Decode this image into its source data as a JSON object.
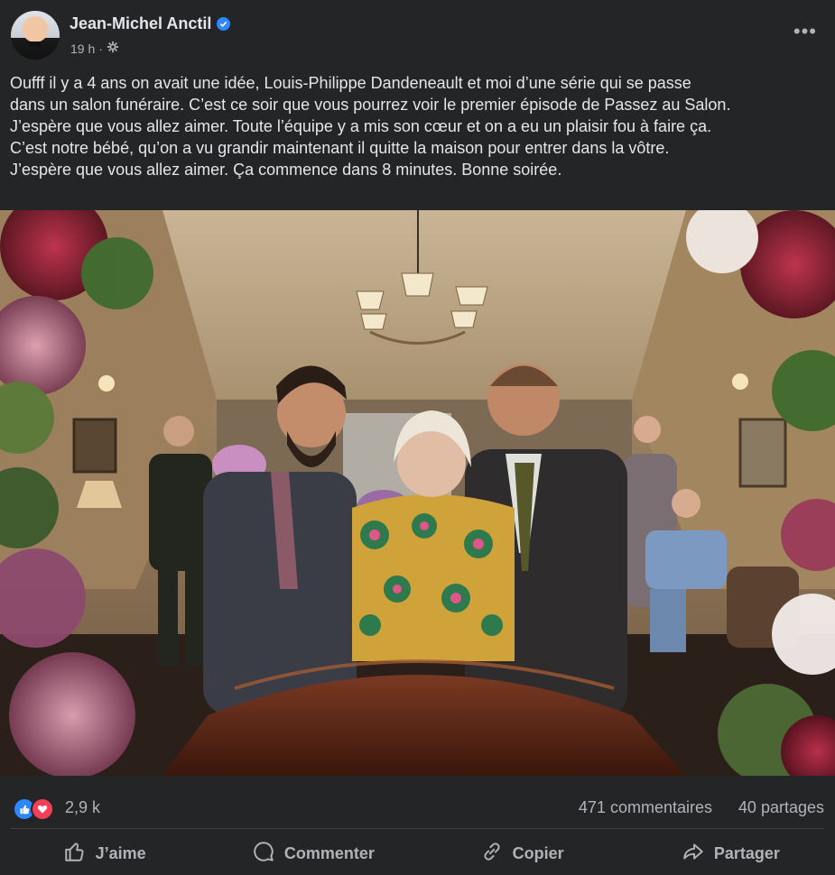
{
  "post": {
    "author": "Jean-Michel Anctil",
    "time": "19 h",
    "audience_icon": "gear-icon",
    "more_icon": "more-horizontal-icon",
    "text": "Oufff il y a 4 ans on avait une idée, Louis-Philippe Dandeneault et moi d’une série qui se passe\ndans un salon funéraire. C’est ce soir que vous pourrez voir le premier épisode de Passez au Salon.\nJ’espère que vous allez aimer. Toute l’équipe y a mis son cœur et on a eu un plaisir fou à faire ça.\nC’est notre bébé, qu’on a vu grandir maintenant il quitte la maison pour entrer dans la vôtre.\nJ’espère que vous allez aimer. Ça commence dans 8 minutes. Bonne soirée."
  },
  "stats": {
    "reactions": "2,9 k",
    "comments": "471 commentaires",
    "shares": "40 partages"
  },
  "actions": {
    "like": "J’aime",
    "comment": "Commenter",
    "copy": "Copier",
    "share": "Partager"
  },
  "colors": {
    "background": "#242526",
    "text": "#e4e6eb",
    "secondary_text": "#b0b3b8",
    "like_blue": "#2d88ff",
    "love_red": "#f33e58"
  }
}
